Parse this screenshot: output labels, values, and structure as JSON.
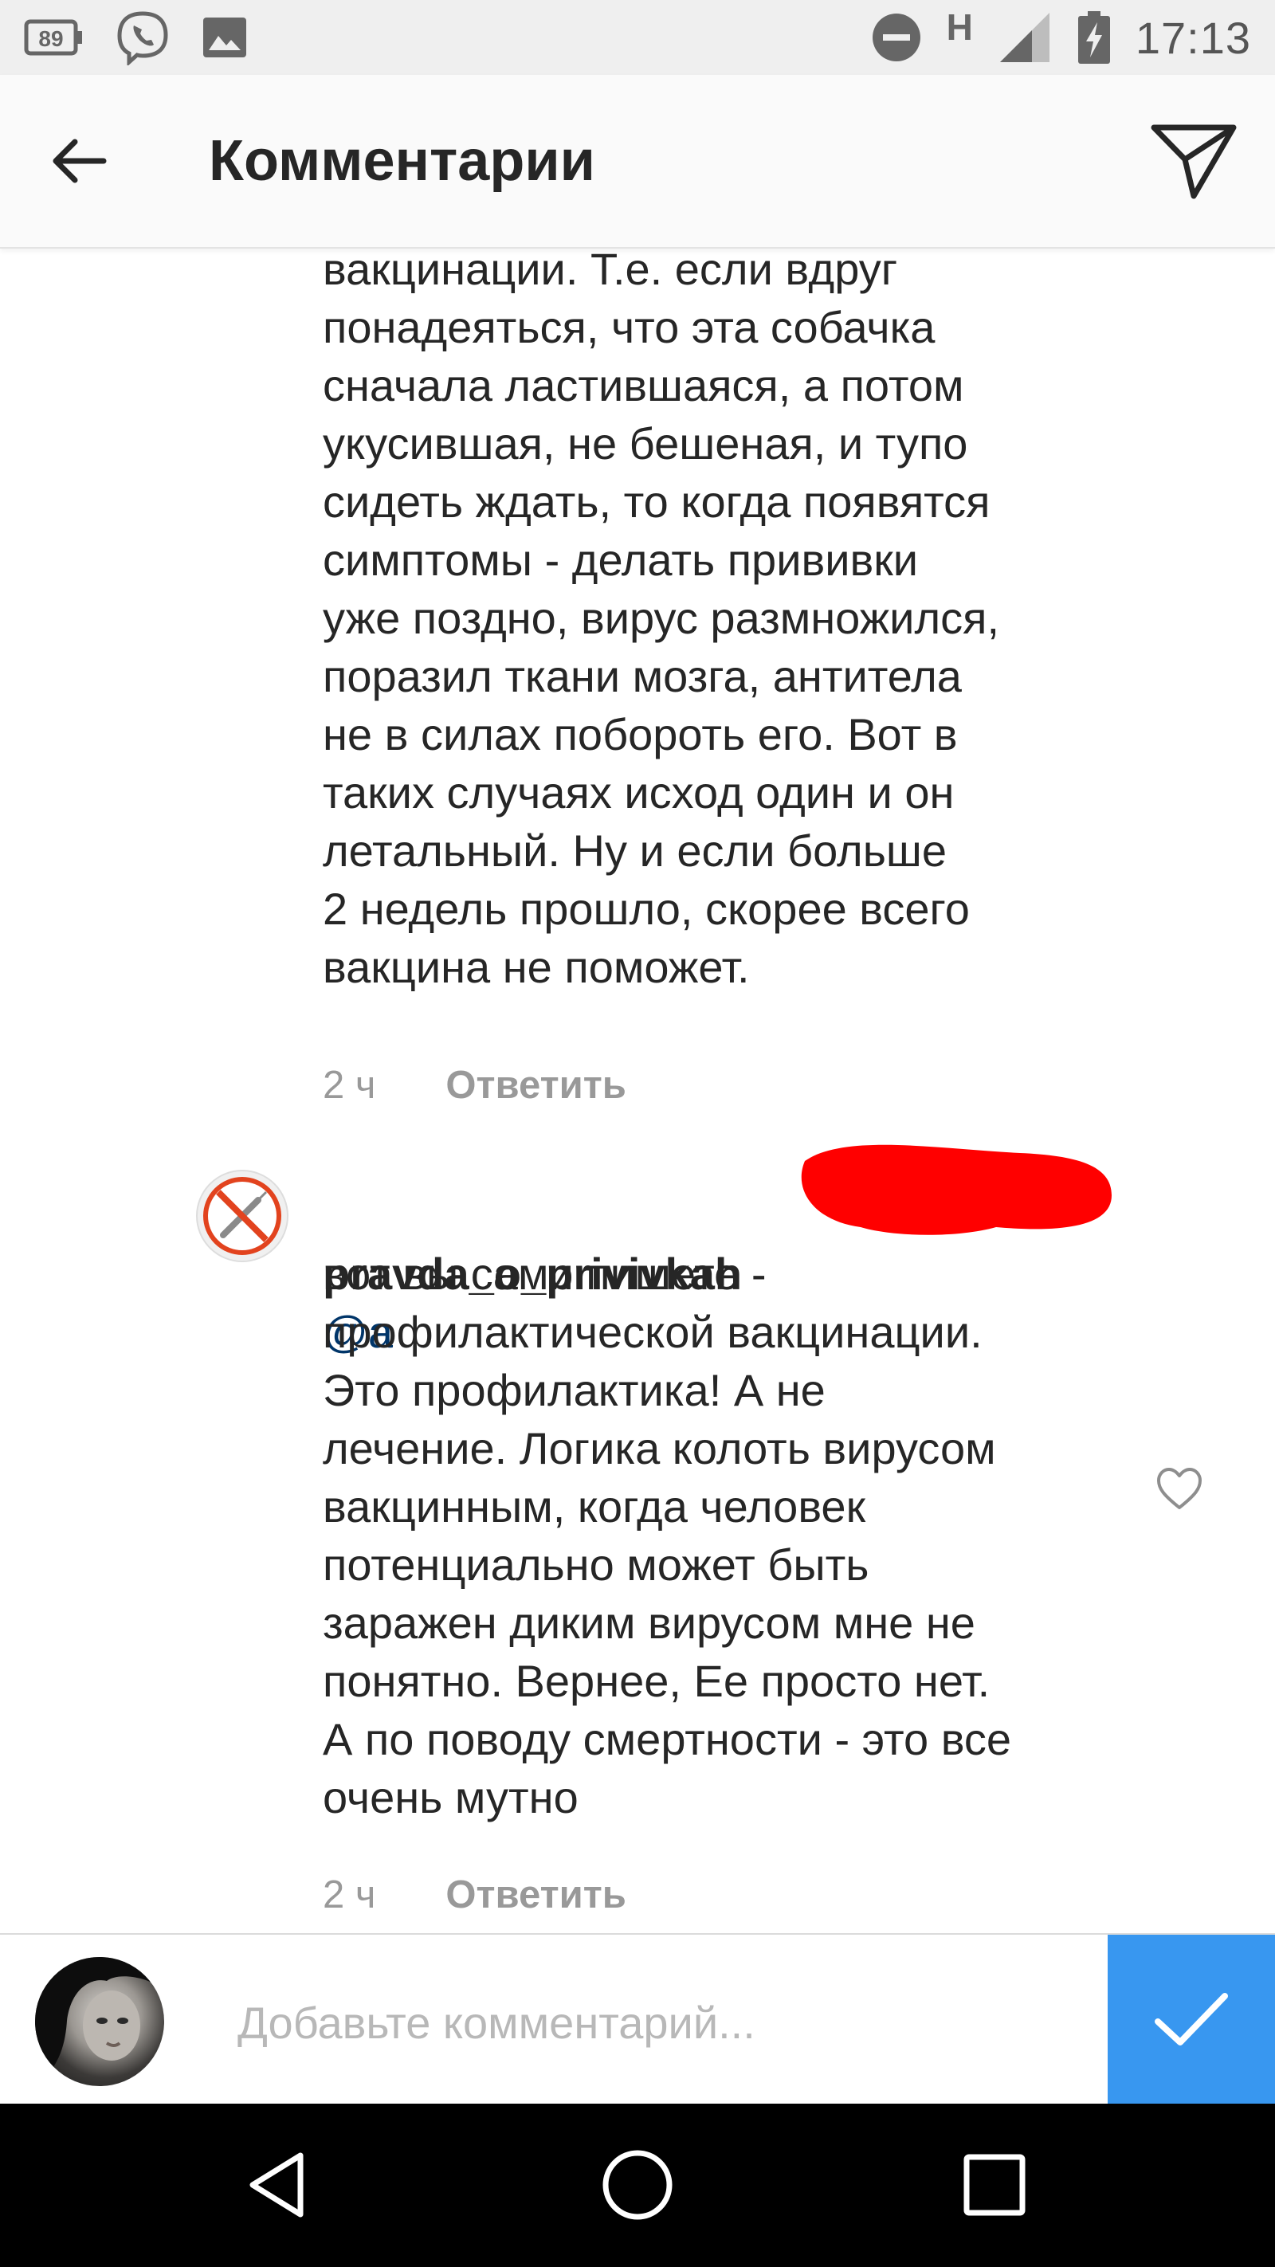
{
  "status_bar": {
    "battery_badge": "89",
    "network_type": "H",
    "time": "17:13",
    "icons": [
      "battery-saver-icon",
      "viber-icon",
      "image-icon",
      "do-not-disturb-icon",
      "signal-icon",
      "battery-charging-icon"
    ]
  },
  "header": {
    "title": "Комментарии",
    "back_icon": "arrow-left-icon",
    "send_icon": "paper-plane-icon"
  },
  "comments": [
    {
      "text": "вакцинации. Т.е. если вдруг\nпонадеяться, что эта собачка\nсначала ластившаяся, а потом\nукусившая, не бешеная, и тупо\nсидеть ждать, то когда появятся\nсимптомы - делать прививки\nуже поздно, вирус размножился,\nпоразил ткани мозга, антитела\nне в силах побороть его. Вот в\nтаких случаях исход один и он\nлетальный. Ну и если больше\n2 недель прошло, скорее всего\nвакцина не поможет.",
      "time": "2 ч",
      "reply_label": "Ответить"
    },
    {
      "username": "pravda_o_privivkah",
      "mention": "@a",
      "text": "вот вы сами пишете -\nпрофилактической вакцинации.\nЭто профилактика! А не\nлечение. Логика колоть вирусом\nвакцинным, когда человек\nпотенциально может быть\nзаражен диким вирусом мне не\nпонятно. Вернее, Ее просто нет.\nА по поводу смертности - это все\nочень мутно",
      "time": "2 ч",
      "reply_label": "Ответить",
      "avatar_icon": "no-syringe-icon",
      "like_icon": "heart-outline-icon"
    }
  ],
  "composer": {
    "placeholder": "Добавьте комментарий...",
    "submit_icon": "checkmark-icon"
  },
  "nav_bar": {
    "icons": [
      "back-triangle-icon",
      "home-circle-icon",
      "recents-square-icon"
    ]
  },
  "colors": {
    "accent": "#3897f0",
    "text": "#262626",
    "meta": "#999999",
    "mention": "#003569",
    "redaction": "#ff0000"
  }
}
